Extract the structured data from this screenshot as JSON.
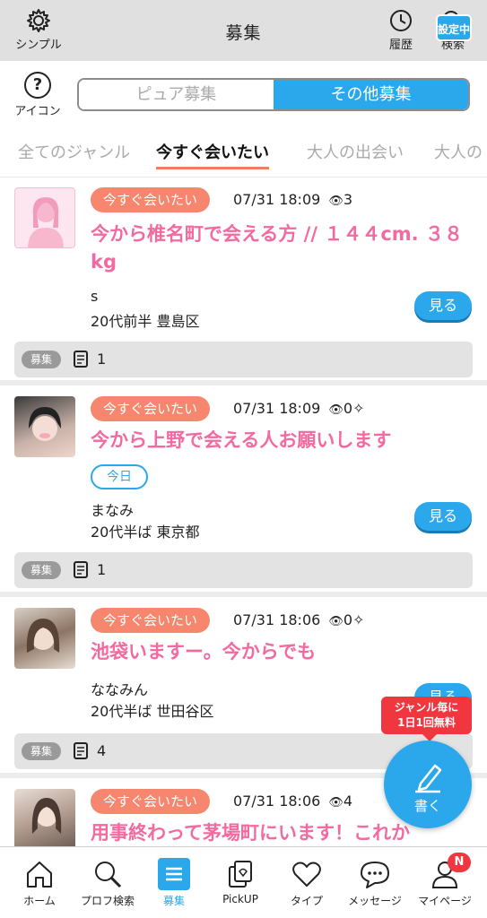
{
  "header": {
    "left_label": "シンプル",
    "title": "募集",
    "history_label": "履歴",
    "search_label": "検索",
    "search_badge": "設定中"
  },
  "toggle": {
    "help_label": "アイコン",
    "help_symbol": "?",
    "options": [
      "ピュア募集",
      "その他募集"
    ],
    "selected": "その他募集"
  },
  "genre_tabs": [
    "全てのジャンル",
    "今すぐ会いたい",
    "大人の出会い",
    "大人の"
  ],
  "genre_active": "今すぐ会いたい",
  "posts": [
    {
      "genre": "今すぐ会いたい",
      "date": "07/31 18:09",
      "views": "3",
      "title": "今から椎名町で会える方 // １４４cm. ３８kg",
      "today_badge": "",
      "name": "s",
      "info": "20代前半 豊島区",
      "view_button": "見る",
      "foot_label": "募集",
      "foot_count": "1"
    },
    {
      "genre": "今すぐ会いたい",
      "date": "07/31 18:09",
      "views": "0",
      "title": "今から上野で会える人お願いします",
      "today_badge": "今日",
      "name": "まなみ",
      "info": "20代半ば 東京都",
      "view_button": "見る",
      "foot_label": "募集",
      "foot_count": "1"
    },
    {
      "genre": "今すぐ会いたい",
      "date": "07/31 18:06",
      "views": "0",
      "title": "池袋いますー。今からでも",
      "today_badge": "",
      "name": "ななみん",
      "info": "20代半ば 世田谷区",
      "view_button": "見る",
      "foot_label": "募集",
      "foot_count": "4"
    },
    {
      "genre": "今すぐ会いたい",
      "date": "07/31 18:06",
      "views": "4",
      "title": "用事終わって茅場町にいます！これか",
      "today_badge": "",
      "name": "",
      "info": "",
      "view_button": "",
      "foot_label": "",
      "foot_count": ""
    }
  ],
  "fab": {
    "label": "書く",
    "promo_line1": "ジャンル毎に",
    "promo_line2": "1日1回無料"
  },
  "bottom_nav": {
    "items": [
      "ホーム",
      "プロフ検索",
      "募集",
      "PickUP",
      "タイプ",
      "メッセージ",
      "マイページ"
    ],
    "active": "募集",
    "badge": "N"
  },
  "colors": {
    "accent": "#2ba8ec",
    "genre_pill": "#f7866f",
    "title_pink": "#f36aa0",
    "promo_red": "#f0373f"
  }
}
